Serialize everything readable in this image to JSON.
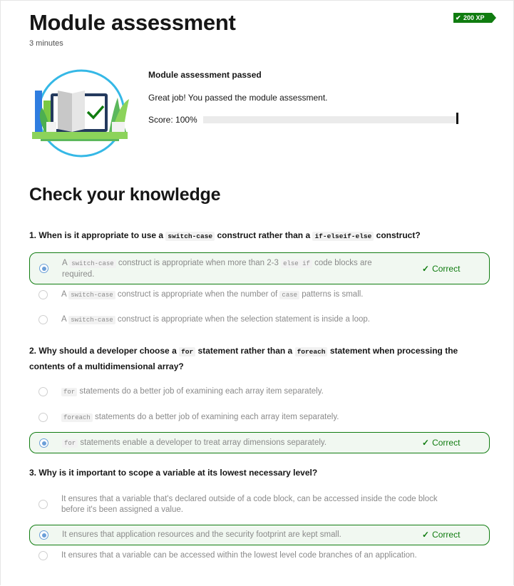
{
  "page": {
    "title": "Module assessment",
    "duration": "3 minutes",
    "xp": "200 XP"
  },
  "assessment": {
    "title": "Module assessment passed",
    "message": "Great job! You passed the module assessment.",
    "score_label": "Score: 100%",
    "score_value": 1.0
  },
  "knowledge": {
    "title": "Check your knowledge",
    "correct_label": "Correct",
    "questions": [
      {
        "number": "1.",
        "parts": [
          "When is it appropriate to use a ",
          "switch-case",
          " construct rather than a ",
          "if-elseif-else",
          " construct?"
        ],
        "choices": [
          {
            "parts": [
              "A ",
              "switch-case",
              " construct is appropriate when more than 2-3 ",
              "else if",
              " code blocks are required."
            ],
            "selected": true
          },
          {
            "parts": [
              "A ",
              "switch-case",
              " construct is appropriate when the number of ",
              "case",
              " patterns is small."
            ],
            "selected": false
          },
          {
            "parts": [
              "A ",
              "switch-case",
              " construct is appropriate when the selection statement is inside a loop."
            ],
            "selected": false
          }
        ]
      },
      {
        "number": "2.",
        "parts": [
          "Why should a developer choose a ",
          "for",
          " statement rather than a ",
          "foreach",
          " statement when processing the contents of a multidimensional array?"
        ],
        "choices": [
          {
            "parts": [
              "",
              "for",
              " statements do a better job of examining each array item separately."
            ],
            "selected": false
          },
          {
            "parts": [
              "",
              "foreach",
              " statements do a better job of examining each array item separately."
            ],
            "selected": false
          },
          {
            "parts": [
              "",
              "for",
              " statements enable a developer to treat array dimensions separately."
            ],
            "selected": true
          }
        ]
      },
      {
        "number": "3.",
        "parts": [
          "Why is it important to scope a variable at its lowest necessary level?"
        ],
        "choices": [
          {
            "parts": [
              "It ensures that a variable that's declared outside of a code block, can be accessed inside the code block before it's been assigned a value."
            ],
            "selected": false
          },
          {
            "parts": [
              "It ensures that application resources and the security footprint are kept small."
            ],
            "selected": true
          },
          {
            "parts": [
              "It ensures that a variable can be accessed within the lowest level code branches of an application."
            ],
            "selected": false
          }
        ]
      }
    ]
  },
  "colors": {
    "accent": "#107c10",
    "radio": "#6b9fd8",
    "selected_bg": "#f1f8f1"
  }
}
